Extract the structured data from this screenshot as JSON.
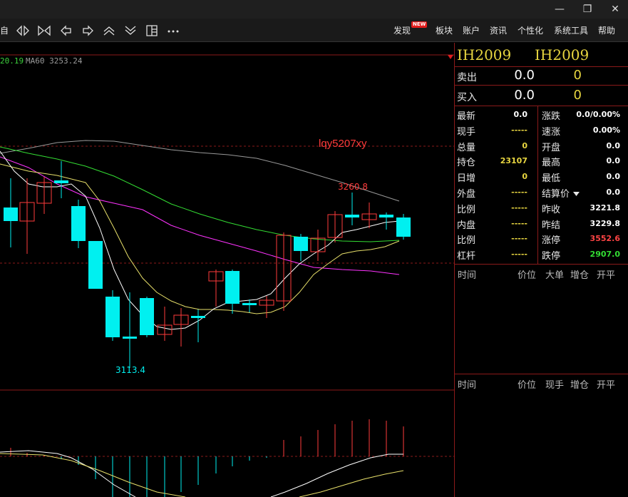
{
  "window": {
    "minimize_glyph": "—",
    "maximize_glyph": "❐",
    "close_glyph": "✕"
  },
  "toolbar": {
    "left_partial_glyph": "自",
    "icons": [
      "zoom-in-icon",
      "zoom-out-icon",
      "shift-left-icon",
      "shift-right-icon",
      "shrink-up-icon",
      "expand-down-icon",
      "layout-icon",
      "more-icon"
    ],
    "menus": [
      "发现",
      "板块",
      "账户",
      "资讯",
      "个性化",
      "系统工具",
      "帮助"
    ],
    "new_badge": "NEW"
  },
  "chart": {
    "ma_labels": [
      {
        "text": "20.19",
        "color": "#3cd03c"
      },
      {
        "text": "MA60 3253.24",
        "color": "#9a9a9a"
      }
    ],
    "watermark": "lqy5207xy",
    "high_label": "3260.8",
    "low_label": "3113.4",
    "colors": {
      "up": "#ff3b3b",
      "down": "#00f0f0",
      "ma5": "#ffffff",
      "ma10": "#e8e06a",
      "ma20": "#ff33ff",
      "ma30": "#33dd33",
      "ma60": "#999999",
      "grid": "#8b1a1a"
    }
  },
  "panel": {
    "symbol_left": "IH2009",
    "symbol_right": "IH2009",
    "sell": {
      "label": "卖出",
      "price": "0.0",
      "volume": "0"
    },
    "buy": {
      "label": "买入",
      "price": "0.0",
      "volume": "0"
    },
    "quote": [
      {
        "l1": "最新",
        "v1": "0.0",
        "c1": "#ffffff",
        "l2": "涨跌",
        "v2": "0.0/0.00%",
        "c2": "#ffffff"
      },
      {
        "l1": "现手",
        "v1": "-----",
        "c1": "#e8d640",
        "l2": "速涨",
        "v2": "0.00%",
        "c2": "#ffffff"
      },
      {
        "l1": "总量",
        "v1": "0",
        "c1": "#e8d640",
        "l2": "开盘",
        "v2": "0.0",
        "c2": "#ffffff"
      },
      {
        "l1": "持仓",
        "v1": "23107",
        "c1": "#e8d640",
        "l2": "最高",
        "v2": "0.0",
        "c2": "#ffffff"
      },
      {
        "l1": "日增",
        "v1": "0",
        "c1": "#e8d640",
        "l2": "最低",
        "v2": "0.0",
        "c2": "#ffffff"
      },
      {
        "l1": "外盘",
        "v1": "-----",
        "c1": "#e8d640",
        "l2": "结算价",
        "v2": "0.0",
        "c2": "#ffffff"
      },
      {
        "l1": "比例",
        "v1": "-----",
        "c1": "#e8d640",
        "l2": "昨收",
        "v2": "3221.8",
        "c2": "#ffffff"
      },
      {
        "l1": "内盘",
        "v1": "-----",
        "c1": "#e8d640",
        "l2": "昨结",
        "v2": "3229.8",
        "c2": "#ffffff"
      },
      {
        "l1": "比例",
        "v1": "-----",
        "c1": "#e8d640",
        "l2": "涨停",
        "v2": "3552.6",
        "c2": "#ff4444"
      },
      {
        "l1": "杠杆",
        "v1": "-----",
        "c1": "#e8d640",
        "l2": "跌停",
        "v2": "2907.0",
        "c2": "#33dd33"
      }
    ],
    "tick_headers_1": [
      "时间",
      "价位",
      "大单",
      "增仓",
      "开平"
    ],
    "tick_headers_2": [
      "时间",
      "价位",
      "现手",
      "增仓",
      "开平"
    ]
  }
}
